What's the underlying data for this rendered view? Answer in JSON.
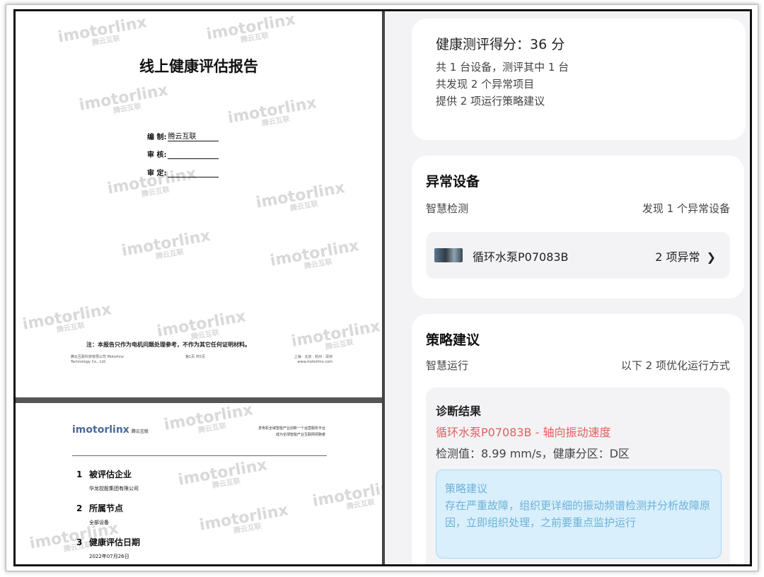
{
  "document": {
    "page1": {
      "title": "线上健康评估报告",
      "watermark_text": "imotorlinx",
      "watermark_sub": "腾云互联",
      "sign_rows": [
        {
          "label": "编 制:",
          "value": "腾云互联"
        },
        {
          "label": "审 核:",
          "value": ""
        },
        {
          "label": "审 定:",
          "value": ""
        }
      ],
      "note": "注：本报告只作为电机问题处理参考，不作为其它任何证明材料。",
      "footer": {
        "left": "腾云互联科技有限公司 Motorlinx Technology Co., Ltd",
        "center": "第1页 共5页",
        "right": "上海 · 北京 · 杭州 · 深圳 www.motorlinx.com"
      }
    },
    "page2": {
      "logo": "imotorlinx",
      "logo_sub": "腾云互联",
      "header_right": [
        "发电机全域智能产业创新一个运营服务平台",
        "成为全球智能产业互联网领跑者"
      ],
      "sections": [
        {
          "num": "1",
          "title": "被评估企业",
          "value": "华龙控股集团有限公司"
        },
        {
          "num": "2",
          "title": "所属节点",
          "value": "全部设备"
        },
        {
          "num": "3",
          "title": "健康评估日期",
          "value": "2022年07月26日"
        }
      ]
    }
  },
  "app": {
    "score": {
      "title": "健康测评得分：36 分",
      "lines": [
        "共 1 台设备，测评其中 1 台",
        "共发现 2 个异常项目",
        "提供 2 项运行策略建议"
      ]
    },
    "abnormal": {
      "title": "异常设备",
      "left": "智慧检测",
      "right": "发现 1 个异常设备",
      "device_name": "循环水泵P07083B",
      "device_count": "2 项异常",
      "chevron": "chevron-right-icon"
    },
    "strategy": {
      "title": "策略建议",
      "left": "智慧运行",
      "right": "以下 2 项优化运行方式",
      "diag_title": "诊断结果",
      "diag_item": "循环水泵P07083B - 轴向振动速度",
      "diag_value": "检测值：8.99 mm/s，健康分区：D区",
      "advice_title": "策略建议",
      "advice_text": "存在严重故障，组织更详细的振动频谱检测并分析故障原因，立即组织处理，之前要重点监护运行"
    }
  },
  "colors": {
    "alert_text": "#e0605a",
    "advice_bg": "#d9effb",
    "advice_text": "#6cb2da",
    "app_bg": "#f3f3f5"
  }
}
